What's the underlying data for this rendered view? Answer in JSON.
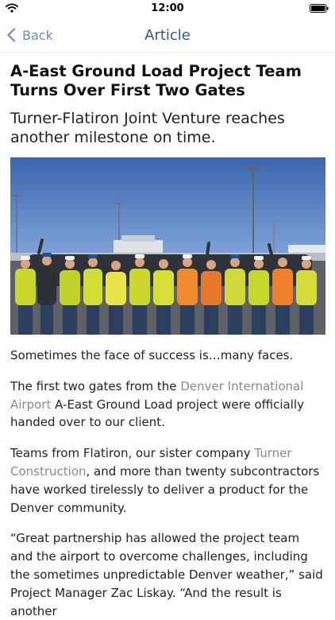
{
  "status_bar": {
    "time": "12:00",
    "icons": [
      "wifi-icon",
      "battery-icon"
    ]
  },
  "nav": {
    "back_label": "Back",
    "title": "Article",
    "back_icon": "chevron-left-icon"
  },
  "colors": {
    "accent": "#6e8bb3",
    "title": "#2f5783",
    "link": "#8a8a8a",
    "body_text": "#222222"
  },
  "article": {
    "headline": "A-East Ground Load Project Team Turns Over First Two Gates",
    "subhead": "Turner-Flatiron Joint Venture reaches another milestone on time.",
    "photo_icon": "team-photo",
    "paragraphs": {
      "p1": "Sometimes the face of success is…many faces.",
      "p2_before": "The first two gates from the ",
      "p2_link": "Denver International Airport",
      "p2_after": " A-East Ground Load project were officially handed over to our client.",
      "p3_before": "Teams from Flatiron, our sister company ",
      "p3_link": "Turner Construction",
      "p3_after": ", and more than twenty subcontractors have worked tirelessly to deliver a product for the Denver community.",
      "p4": "“Great partnership has allowed the project team and the airport to overcome challenges, including the sometimes unpredictable Denver weather,” said Project Manager Zac Liskay. “And the result is another"
    }
  }
}
